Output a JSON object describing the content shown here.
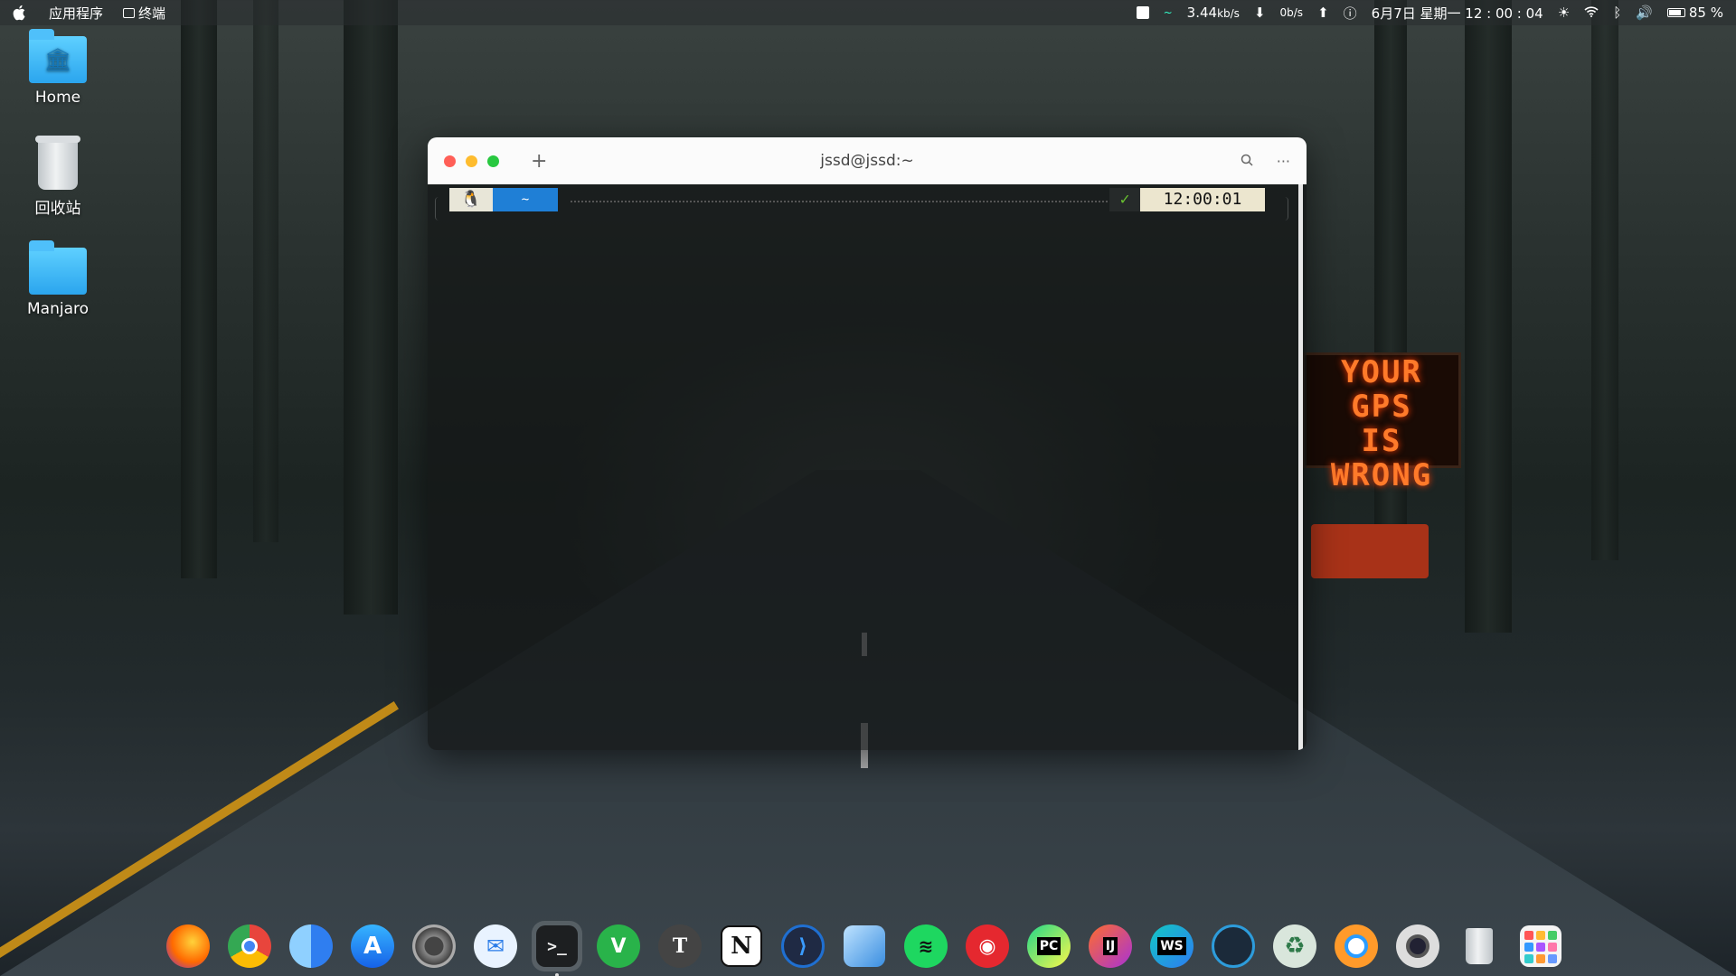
{
  "topbar": {
    "apple_icon": "apple-logo",
    "menu_apps": "应用程序",
    "menu_terminal": "终端",
    "net_down": "3.44",
    "net_down_unit": "kb/s",
    "net_up": "0b/s",
    "datetime": "6月7日 星期一 12 : 00 : 04",
    "battery": "85 %"
  },
  "desktop": {
    "icons": [
      {
        "label": "Home",
        "icon": "home-folder-icon"
      },
      {
        "label": "回收站",
        "icon": "trash-icon"
      },
      {
        "label": "Manjaro",
        "icon": "folder-icon"
      }
    ]
  },
  "terminal": {
    "title": "jssd@jssd:~",
    "prompt_os_icon": "🐧",
    "prompt_dir": "~",
    "prompt_status": "✓",
    "prompt_time": "12:00:01"
  },
  "wallpaper": {
    "sign_line1": "YOUR GPS",
    "sign_line2": "IS",
    "sign_line3": "WRONG"
  },
  "dock": {
    "apps": [
      {
        "name": "firefox",
        "bg": "#ff7a00"
      },
      {
        "name": "chrome",
        "bg": "#e8453c"
      },
      {
        "name": "finder",
        "bg": "#3a8ef6"
      },
      {
        "name": "app-store",
        "bg": "#1e90ff"
      },
      {
        "name": "settings",
        "bg": "#6a6a6a"
      },
      {
        "name": "mail",
        "bg": "#e9f3ff"
      },
      {
        "name": "terminal",
        "bg": "#1d1f21"
      },
      {
        "name": "vim",
        "bg": "#29b34a"
      },
      {
        "name": "typora",
        "bg": "#555"
      },
      {
        "name": "notion",
        "bg": "#ffffff"
      },
      {
        "name": "vscode",
        "bg": "#1f6fd1"
      },
      {
        "name": "draw",
        "bg": "#4aa8e8"
      },
      {
        "name": "spotify",
        "bg": "#1ed760"
      },
      {
        "name": "netease-music",
        "bg": "#e5282f"
      },
      {
        "name": "pycharm",
        "bg": "#21d789"
      },
      {
        "name": "intellij",
        "bg": "#fe6d2d"
      },
      {
        "name": "webstorm",
        "bg": "#12c8c4"
      },
      {
        "name": "system-monitor",
        "bg": "#1b2a3a"
      },
      {
        "name": "recycle",
        "bg": "#7a9a88"
      },
      {
        "name": "browser-circle",
        "bg": "#ff9a2a"
      },
      {
        "name": "camera",
        "bg": "#2b2b2b"
      },
      {
        "name": "trash",
        "bg": "#cfd4d7"
      },
      {
        "name": "launchpad",
        "bg": "#f4f4f4"
      }
    ],
    "labels": {
      "pycharm": "PC",
      "intellij": "IJ",
      "webstorm": "WS",
      "notion": "N",
      "typora": "T"
    }
  }
}
